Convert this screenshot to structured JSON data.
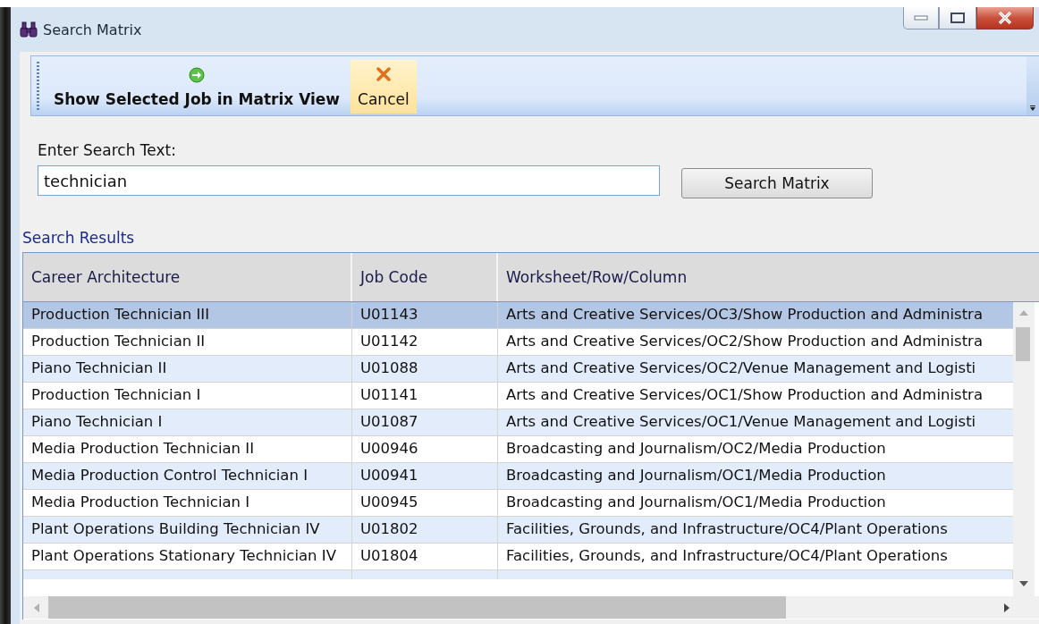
{
  "window": {
    "title": "Search Matrix"
  },
  "toolbar": {
    "buttons": [
      {
        "label": "Show Selected Job in Matrix View",
        "kind": "go",
        "highlighted": false
      },
      {
        "label": "Cancel",
        "kind": "cancel",
        "highlighted": true
      }
    ]
  },
  "search": {
    "label": "Enter Search Text:",
    "value": "technician",
    "button": "Search Matrix"
  },
  "results": {
    "title": "Search Results",
    "columns": [
      "Career Architecture",
      "Job Code",
      "Worksheet/Row/Column"
    ],
    "rows": [
      {
        "cells": [
          "Production Technician III",
          "U01143",
          "Arts and Creative Services/OC3/Show Production and Administra"
        ],
        "selected": true
      },
      {
        "cells": [
          "Production Technician II",
          "U01142",
          "Arts and Creative Services/OC2/Show Production and Administra"
        ],
        "selected": false
      },
      {
        "cells": [
          "Piano Technician II",
          "U01088",
          "Arts and Creative Services/OC2/Venue Management and Logisti"
        ],
        "selected": false
      },
      {
        "cells": [
          "Production Technician I",
          "U01141",
          "Arts and Creative Services/OC1/Show Production and Administra"
        ],
        "selected": false
      },
      {
        "cells": [
          "Piano Technician I",
          "U01087",
          "Arts and Creative Services/OC1/Venue Management and Logisti"
        ],
        "selected": false
      },
      {
        "cells": [
          "Media Production Technician II",
          "U00946",
          "Broadcasting and Journalism/OC2/Media Production"
        ],
        "selected": false
      },
      {
        "cells": [
          "Media Production Control Technician I",
          "U00941",
          "Broadcasting and Journalism/OC1/Media Production"
        ],
        "selected": false
      },
      {
        "cells": [
          "Media Production Technician I",
          "U00945",
          "Broadcasting and Journalism/OC1/Media Production"
        ],
        "selected": false
      },
      {
        "cells": [
          "Plant Operations Building Technician IV",
          "U01802",
          "Facilities, Grounds, and Infrastructure/OC4/Plant Operations"
        ],
        "selected": false
      },
      {
        "cells": [
          "Plant Operations Stationary Technician IV",
          "U01804",
          "Facilities, Grounds, and Infrastructure/OC4/Plant Operations"
        ],
        "selected": false
      }
    ]
  }
}
